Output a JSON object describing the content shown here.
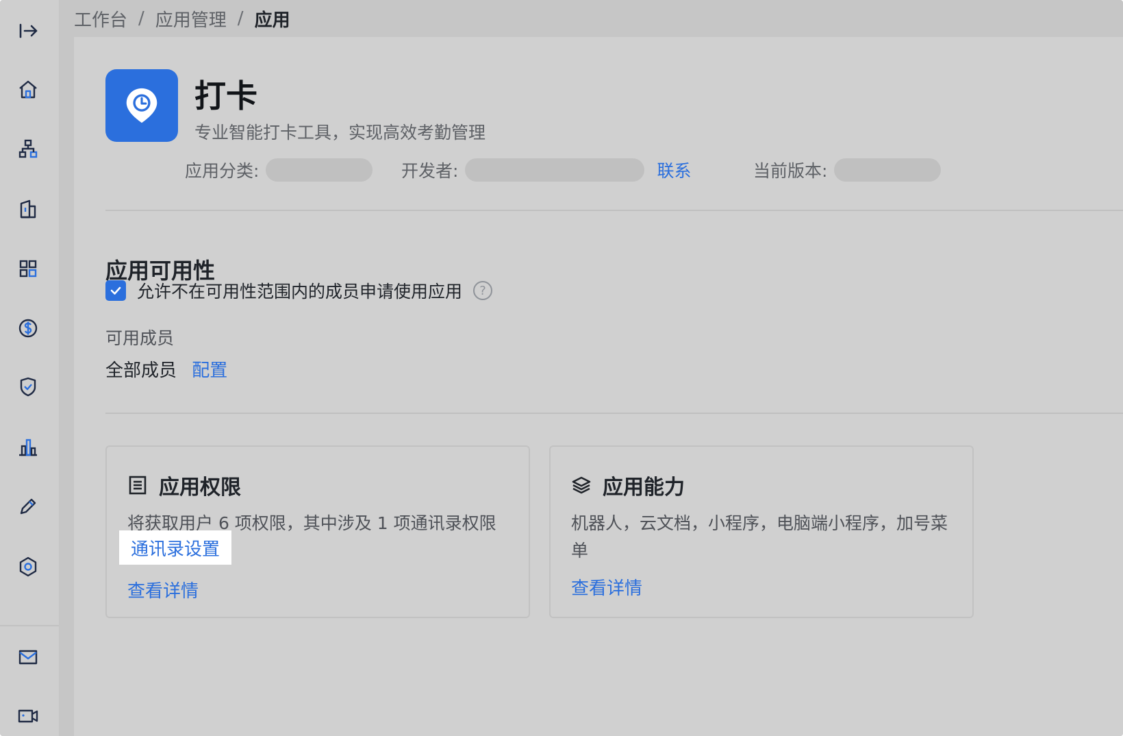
{
  "breadcrumb": {
    "items": [
      "工作台",
      "应用管理",
      "应用"
    ],
    "separator": "/"
  },
  "sidebar": {
    "items": [
      {
        "name": "expand",
        "icon": "expand-arrow-icon"
      },
      {
        "name": "home",
        "icon": "home-icon"
      },
      {
        "name": "organization",
        "icon": "org-chart-icon"
      },
      {
        "name": "company",
        "icon": "building-icon"
      },
      {
        "name": "apps",
        "icon": "grid-icon"
      },
      {
        "name": "billing",
        "icon": "dollar-icon"
      },
      {
        "name": "security",
        "icon": "shield-check-icon"
      },
      {
        "name": "analytics",
        "icon": "bar-chart-icon"
      },
      {
        "name": "customize",
        "icon": "pencil-icon"
      },
      {
        "name": "settings",
        "icon": "hexagon-settings-icon"
      },
      {
        "name": "mail",
        "icon": "mail-icon"
      },
      {
        "name": "meeting",
        "icon": "video-icon"
      }
    ]
  },
  "app": {
    "name": "打卡",
    "description": "专业智能打卡工具，实现高效考勤管理",
    "category_label": "应用分类:",
    "developer_label": "开发者:",
    "contact_link": "联系",
    "version_label": "当前版本:"
  },
  "availability": {
    "title": "应用可用性",
    "checkbox_label": "允许不在可用性范围内的成员申请使用应用",
    "checkbox_checked": true,
    "help_symbol": "?",
    "members_label": "可用成员",
    "members_value": "全部成员",
    "configure_link": "配置"
  },
  "cards": {
    "permissions": {
      "title": "应用权限",
      "text": "将获取用户 6 项权限，其中涉及 1 项通讯录权限",
      "contacts_settings_link": "通讯录设置",
      "details_link": "查看详情"
    },
    "capabilities": {
      "title": "应用能力",
      "text": "机器人，云文档，小程序，电脑端小程序，加号菜单",
      "details_link": "查看详情"
    }
  },
  "colors": {
    "accent": "#2b6fdd",
    "icon_dark": "#1f2a44"
  }
}
